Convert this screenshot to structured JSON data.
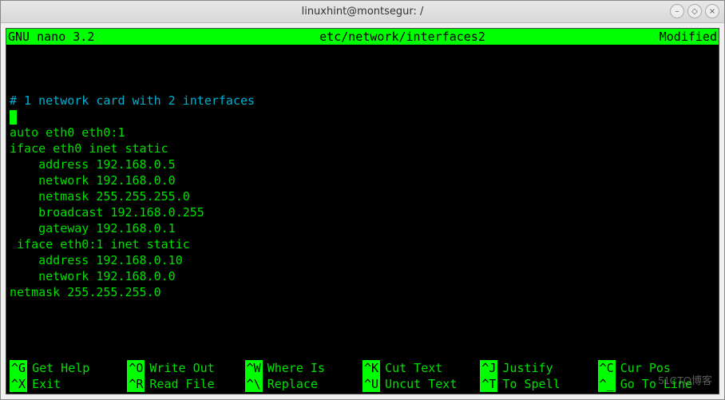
{
  "window": {
    "title": "linuxhint@montsegur: /"
  },
  "nano": {
    "app": "GNU nano 3.2",
    "file": "etc/network/interfaces2",
    "status": "Modified"
  },
  "editor": {
    "comment_line": "# 1 network card with 2 interfaces",
    "lines": [
      "auto eth0 eth0:1",
      "iface eth0 inet static",
      "    address 192.168.0.5",
      "    network 192.168.0.0",
      "    netmask 255.255.255.0",
      "    broadcast 192.168.0.255",
      "    gateway 192.168.0.1",
      " iface eth0:1 inet static",
      "    address 192.168.0.10",
      "    network 192.168.0.0",
      "netmask 255.255.255.0"
    ]
  },
  "shortcuts": {
    "r1c1": {
      "key": "^G",
      "label": "Get Help"
    },
    "r1c2": {
      "key": "^O",
      "label": "Write Out"
    },
    "r1c3": {
      "key": "^W",
      "label": "Where Is"
    },
    "r1c4": {
      "key": "^K",
      "label": "Cut Text"
    },
    "r1c5": {
      "key": "^J",
      "label": "Justify"
    },
    "r1c6": {
      "key": "^C",
      "label": "Cur Pos"
    },
    "r2c1": {
      "key": "^X",
      "label": "Exit"
    },
    "r2c2": {
      "key": "^R",
      "label": "Read File"
    },
    "r2c3": {
      "key": "^\\",
      "label": "Replace"
    },
    "r2c4": {
      "key": "^U",
      "label": "Uncut Text"
    },
    "r2c5": {
      "key": "^T",
      "label": "To Spell"
    },
    "r2c6": {
      "key": "^_",
      "label": "Go To Line"
    }
  },
  "watermark": "51CTO博客"
}
